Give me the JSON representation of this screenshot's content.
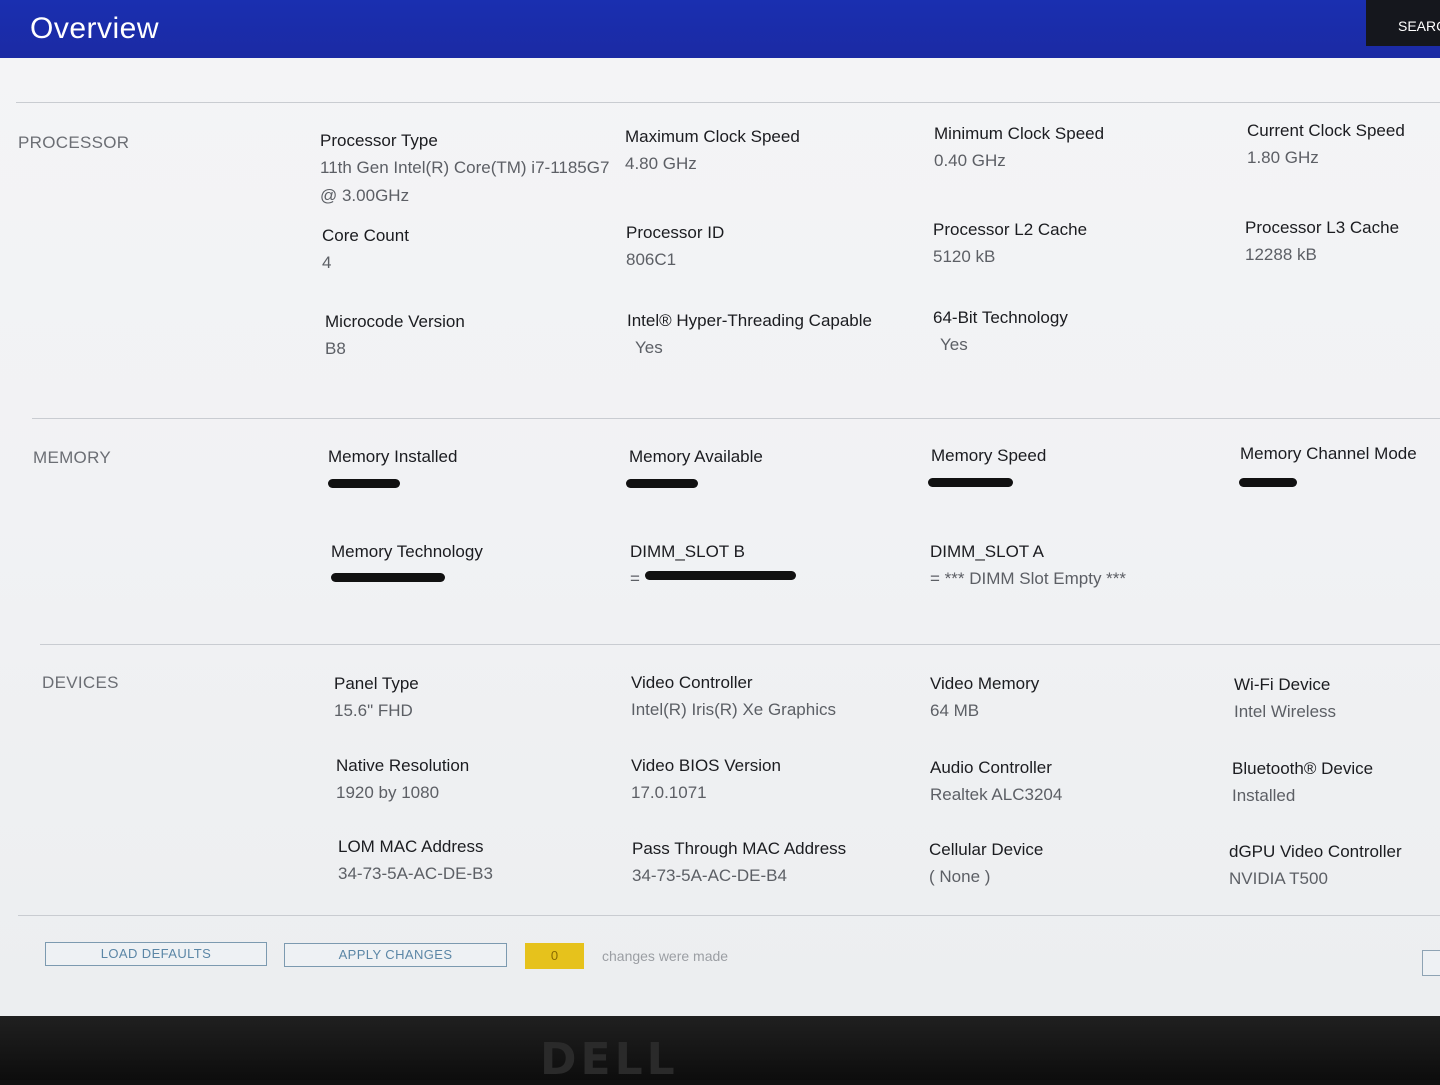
{
  "header": {
    "title": "Overview",
    "search_label": "SEARCH"
  },
  "processor": {
    "section_label": "PROCESSOR",
    "processor_type": {
      "label": "Processor Type",
      "value": "11th Gen Intel(R) Core(TM) i7-1185G7 @ 3.00GHz"
    },
    "max_clock": {
      "label": "Maximum Clock Speed",
      "value": "4.80 GHz"
    },
    "min_clock": {
      "label": "Minimum Clock Speed",
      "value": "0.40 GHz"
    },
    "current_clock": {
      "label": "Current Clock Speed",
      "value": "1.80 GHz"
    },
    "core_count": {
      "label": "Core Count",
      "value": "4"
    },
    "processor_id": {
      "label": "Processor ID",
      "value": "806C1"
    },
    "l2_cache": {
      "label": "Processor L2 Cache",
      "value": "5120 kB"
    },
    "l3_cache": {
      "label": "Processor L3 Cache",
      "value": "12288 kB"
    },
    "microcode": {
      "label": "Microcode Version",
      "value": "B8"
    },
    "hyper_threading": {
      "label": "Intel® Hyper-Threading Capable",
      "value": "Yes"
    },
    "bit64": {
      "label": "64-Bit Technology",
      "value": "Yes"
    }
  },
  "memory": {
    "section_label": "MEMORY",
    "installed": {
      "label": "Memory Installed"
    },
    "available": {
      "label": "Memory Available"
    },
    "speed": {
      "label": "Memory Speed"
    },
    "channel_mode": {
      "label": "Memory Channel Mode"
    },
    "technology": {
      "label": "Memory Technology"
    },
    "dimm_b": {
      "label": "DIMM_SLOT B",
      "value_prefix": "="
    },
    "dimm_a": {
      "label": "DIMM_SLOT A",
      "value": "= *** DIMM Slot Empty ***"
    }
  },
  "devices": {
    "section_label": "DEVICES",
    "panel_type": {
      "label": "Panel Type",
      "value": "15.6\" FHD"
    },
    "video_controller": {
      "label": "Video Controller",
      "value": "Intel(R) Iris(R) Xe Graphics"
    },
    "video_memory": {
      "label": "Video Memory",
      "value": "64 MB"
    },
    "wifi": {
      "label": "Wi-Fi Device",
      "value": "Intel Wireless"
    },
    "native_resolution": {
      "label": "Native Resolution",
      "value": "1920 by 1080"
    },
    "video_bios": {
      "label": "Video BIOS Version",
      "value": "17.0.1071"
    },
    "audio": {
      "label": "Audio Controller",
      "value": "Realtek ALC3204"
    },
    "bluetooth": {
      "label": "Bluetooth® Device",
      "value": "Installed"
    },
    "lom_mac": {
      "label": "LOM MAC Address",
      "value": "34-73-5A-AC-DE-B3"
    },
    "passthrough_mac": {
      "label": "Pass Through MAC Address",
      "value": "34-73-5A-AC-DE-B4"
    },
    "cellular": {
      "label": "Cellular Device",
      "value": "( None )"
    },
    "dgpu": {
      "label": "dGPU Video Controller",
      "value": "NVIDIA T500"
    }
  },
  "footer": {
    "load_defaults": "LOAD DEFAULTS",
    "apply_changes": "APPLY CHANGES",
    "change_count": "0",
    "changes_text": "changes were made"
  },
  "bezel": {
    "logo_text": "DELL"
  }
}
